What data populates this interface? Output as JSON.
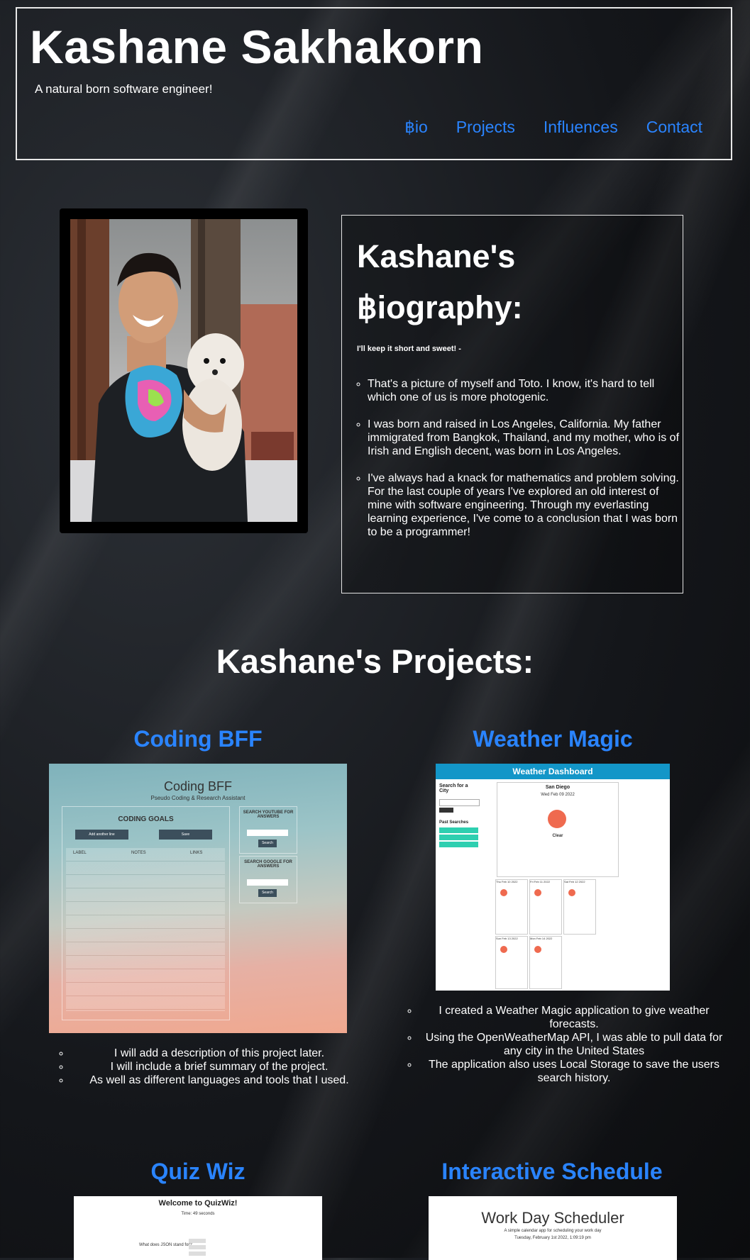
{
  "header": {
    "title": "Kashane Sakhakorn",
    "tagline": "A natural born software engineer!",
    "nav": [
      "฿io",
      "Projects",
      "Influences",
      "Contact"
    ]
  },
  "bio": {
    "heading_line1": "Kashane's",
    "heading_line2": "฿iography:",
    "intro": "I'll keep it short and sweet! -",
    "items": [
      "That's a picture of myself and Toto. I know, it's hard to tell which one of us is more photogenic.",
      "I was born and raised in Los Angeles, California. My father immigrated from Bangkok, Thailand, and my mother, who is of Irish and English decent, was born in Los Angeles.",
      "I've always had a knack for mathematics and problem solving. For the last couple of years I've explored an old interest of mine with software engineering. Through my everlasting learning experience, I've come to a conclusion that I was born to be a programmer!"
    ]
  },
  "projects": {
    "heading": "Kashane's Projects:",
    "items": [
      {
        "title": "Coding BFF",
        "shot": {
          "title": "Coding BFF",
          "subtitle": "Pseudo Coding & Research Assistant",
          "goals": "CODING GOALS",
          "add": "Add another line",
          "save": "Save",
          "cols": [
            "LABEL",
            "NOTES",
            "LINKS"
          ],
          "yt": "SEARCH YOUTUBE FOR ANSWERS",
          "google": "SEARCH GOOGLE FOR ANSWERS",
          "search": "Search"
        },
        "bullets": [
          "I will add a description of this project later.",
          "I will include a brief summary of the project.",
          "As well as different languages and tools that I used."
        ]
      },
      {
        "title": "Weather Magic",
        "shot": {
          "header": "Weather Dashboard",
          "search_label": "Search for a City",
          "past": "Past Searches",
          "city": "San Diego",
          "date": "Wed Feb 09 2022",
          "condition": "Clear",
          "days": [
            "Thu Feb 10 2022",
            "Fri Feb 11 2022",
            "Sat Feb 12 2022",
            "Sun Feb 13 2022",
            "Mon Feb 14 2022"
          ]
        },
        "bullets": [
          "I created a Weather Magic application to give weather forecasts.",
          "Using the OpenWeatherMap API, I was able to pull data for any city in the United States",
          "The application also uses Local Storage to save the users search history."
        ]
      },
      {
        "title": "Quiz Wiz",
        "shot": {
          "title": "Welcome to QuizWiz!",
          "time": "Time: 49 seconds",
          "question": "What does JSON stand for?"
        }
      },
      {
        "title": "Interactive Schedule",
        "shot": {
          "title": "Work Day Scheduler",
          "subtitle": "A simple calendar app for scheduling your work day",
          "date": "Tuesday, February 1st 2022, 1:09:19 pm"
        }
      }
    ]
  },
  "colors": {
    "link": "#2a84ff",
    "background": "#14161a",
    "border": "#e8e8e8"
  }
}
